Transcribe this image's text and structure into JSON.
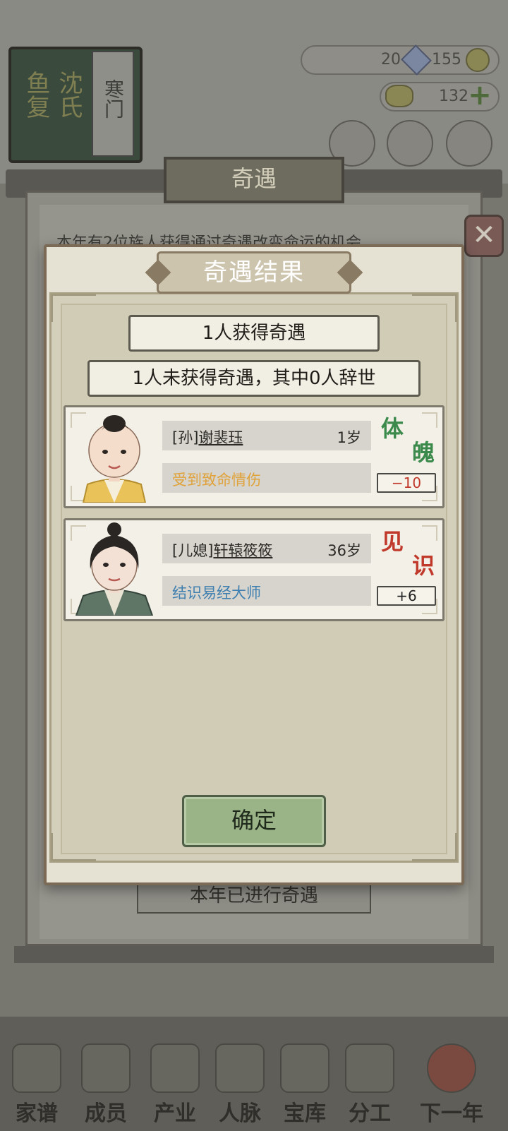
{
  "background": {
    "book": {
      "title_left": "鱼复",
      "title_right": "沈氏",
      "spine": "寒门"
    },
    "resources": {
      "silver": "20",
      "ingot": "155",
      "gold": "132"
    },
    "outer_panel": {
      "title": "奇遇",
      "description": "本年有2位族人获得通过奇遇改变命运的机会",
      "status_label": "本年已进行奇遇"
    },
    "nav": [
      "家谱",
      "成员",
      "产业",
      "人脉",
      "宝库",
      "分工",
      "下一年"
    ]
  },
  "modal": {
    "title": "奇遇结果",
    "summary_gained": "1人获得奇遇",
    "summary_not_gained": "1人未获得奇遇，其中0人辞世",
    "results": [
      {
        "relation": "[孙]",
        "name": "谢裴珏",
        "age": "1岁",
        "event": "受到致命情伤",
        "event_color": "#e0a23a",
        "stat_name": "体魄",
        "stat_color": "#3b8a4c",
        "delta": "−10",
        "delta_color": "#c0392b"
      },
      {
        "relation": "[儿媳]",
        "name": "轩辕筱筱",
        "age": "36岁",
        "event": "结识易经大师",
        "event_color": "#3f7fb0",
        "stat_name": "见识",
        "stat_color": "#c0392b",
        "delta": "+6",
        "delta_color": "#222222"
      }
    ],
    "confirm_label": "确定"
  }
}
